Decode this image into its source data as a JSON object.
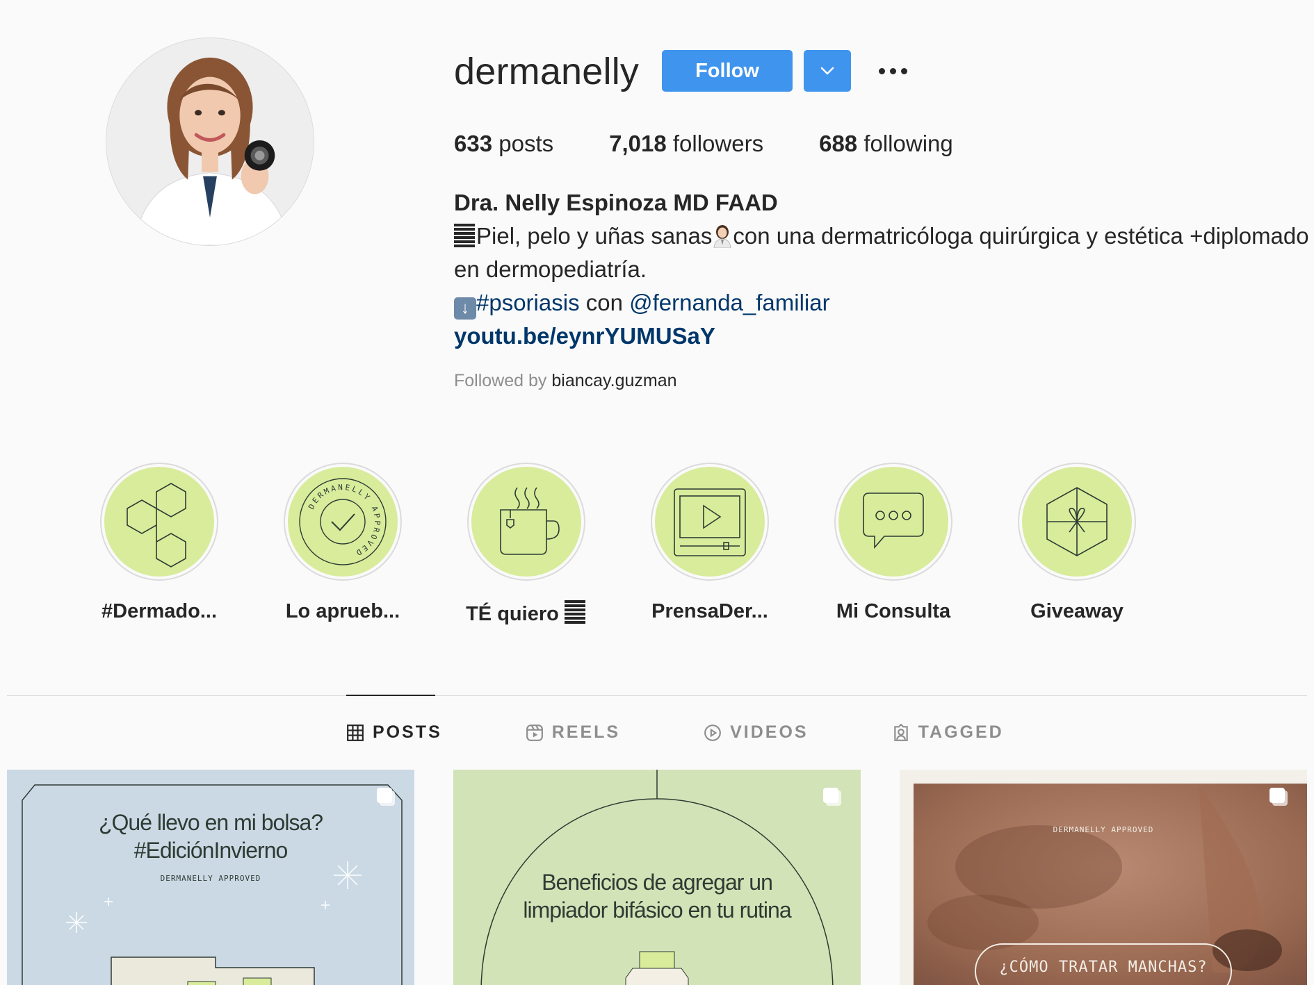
{
  "profile": {
    "username": "dermanelly",
    "follow_label": "Follow",
    "dropdown_icon": "chevron-down-icon",
    "more_icon": "more-options-icon",
    "stats": {
      "posts_count": "633",
      "posts_label": "posts",
      "followers_count": "7,018",
      "followers_label": "followers",
      "following_count": "688",
      "following_label": "following"
    },
    "bio": {
      "full_name": "Dra. Nelly Espinoza MD FAAD",
      "line1_text": "Piel, pelo y uñas sanas",
      "line1_text2": "con una dermatricóloga quirúrgica y estética +diplomado en dermopediatría.",
      "hashtag": "#psoriasis",
      "con": " con ",
      "mention": "@fernanda_familiar",
      "url": "youtu.be/eynrYUMUSaY"
    },
    "followed_by_label": "Followed by",
    "followed_by_user": "biancay.guzman"
  },
  "highlights": [
    {
      "label": "#Dermado...",
      "icon": "molecule-icon"
    },
    {
      "label": "Lo aprueb...",
      "icon": "approved-seal-icon",
      "seal_text": "DERMANELLY APPROVED"
    },
    {
      "label": "TÉ quiero",
      "icon": "tea-cup-icon"
    },
    {
      "label": "PrensaDer...",
      "icon": "video-player-icon"
    },
    {
      "label": "Mi Consulta",
      "icon": "chat-bubble-icon"
    },
    {
      "label": "Giveaway",
      "icon": "gift-icon"
    }
  ],
  "tabs": [
    {
      "label": "POSTS",
      "icon": "grid-icon",
      "active": true
    },
    {
      "label": "REELS",
      "icon": "reels-icon",
      "active": false
    },
    {
      "label": "VIDEOS",
      "icon": "play-circle-icon",
      "active": false
    },
    {
      "label": "TAGGED",
      "icon": "tagged-user-icon",
      "active": false
    }
  ],
  "posts": [
    {
      "title_line1": "¿Qué llevo en mi bolsa?",
      "title_line2": "#EdiciónInvierno",
      "subtitle": "DERMANELLY APPROVED",
      "bg": "#cbd9e5"
    },
    {
      "title_line1": "Beneficios de agregar un",
      "title_line2": "limpiador bifásico en tu rutina",
      "bg": "#d2e3b7"
    },
    {
      "subtitle": "DERMANELLY APPROVED",
      "button": "¿CÓMO TRATAR MANCHAS?",
      "bg": "#a7735c"
    }
  ],
  "colors": {
    "follow_blue": "#3f94ee",
    "highlight_green": "#d8ec9c",
    "link_blue": "#00376b",
    "text": "#262626",
    "muted": "#8e8e8e"
  }
}
